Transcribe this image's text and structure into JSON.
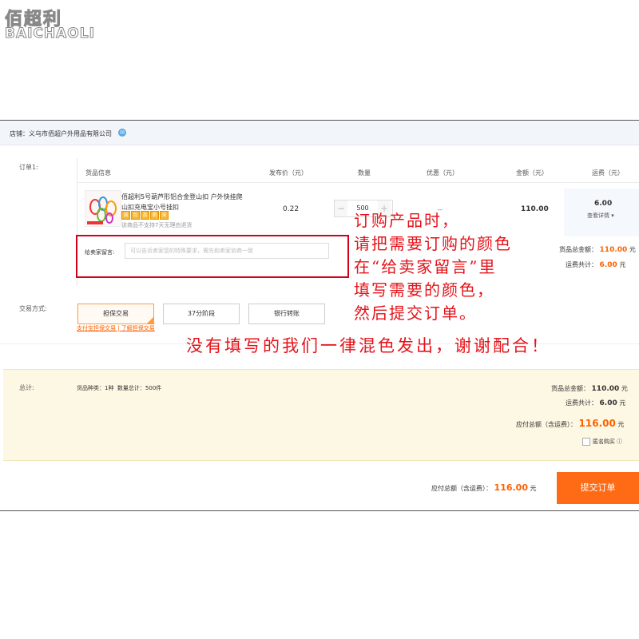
{
  "logo": {
    "cn": "佰超利",
    "en": "BAICHAOLI"
  },
  "shop": {
    "label": "店铺：",
    "name": "义乌市佰超户外用品有限公司",
    "icon": "chat-icon"
  },
  "order": {
    "label": "订单1:",
    "columns": {
      "goods": "货品信息",
      "price": "发布价（元）",
      "qty": "数量",
      "discount": "优惠（元）",
      "amount": "金额（元）",
      "shipping": "运费（元）"
    },
    "product": {
      "title": "佰超利5号葫芦形铝合金登山扣 户外快挂爬山扣充电宝小号挂扣",
      "badges": [
        "诚",
        "包",
        "品",
        "质",
        "采"
      ],
      "notice": "该商品不支持7天无理由退货",
      "price": "0.22",
      "quantity": "500",
      "minus": "−",
      "plus": "+",
      "discount": "--",
      "amount": "110.00",
      "shipping": "6.00",
      "shipping_detail": "查看详情"
    },
    "message": {
      "label": "给卖家留言:",
      "placeholder": "可以告诉卖家您的特殊要求，需先和卖家协商一致"
    },
    "subtotal": {
      "goods_label": "货品总金额：",
      "goods_value": "110.00",
      "ship_label": "运费共计：",
      "ship_value": "6.00",
      "unit": "元"
    }
  },
  "trade": {
    "label": "交易方式:",
    "options": [
      "担保交易",
      "37分阶段",
      "银行转账"
    ],
    "selected": "担保交易",
    "tip": "支付宝担保交易 | 了解担保交易"
  },
  "total": {
    "label": "总计:",
    "kinds": "货品种类：1种",
    "qty_total": "数量总计：500件",
    "goods_label": "货品总金额：",
    "goods_value": "110.00",
    "ship_label": "运费共计：",
    "ship_value": "6.00",
    "unit": "元",
    "grand_label": "应付总额（含运费）：",
    "grand_value": "116.00",
    "anonymous": "匿名购买"
  },
  "footer": {
    "pay_label": "应付总额（含运费）：",
    "pay_value": "116.00",
    "unit": "元",
    "submit": "提交订单"
  },
  "annotation": {
    "lines": [
      "订购产品时，",
      "请把需要订购的颜色",
      "在“给卖家留言”里",
      "填写需要的颜色，",
      "然后提交订单。"
    ],
    "footer": "没有填写的我们一律混色发出，谢谢配合！"
  },
  "colors": {
    "accent": "#ff6000",
    "submit": "#ff6a14",
    "annotation": "#e5131a",
    "panel": "#fdf8e4"
  }
}
